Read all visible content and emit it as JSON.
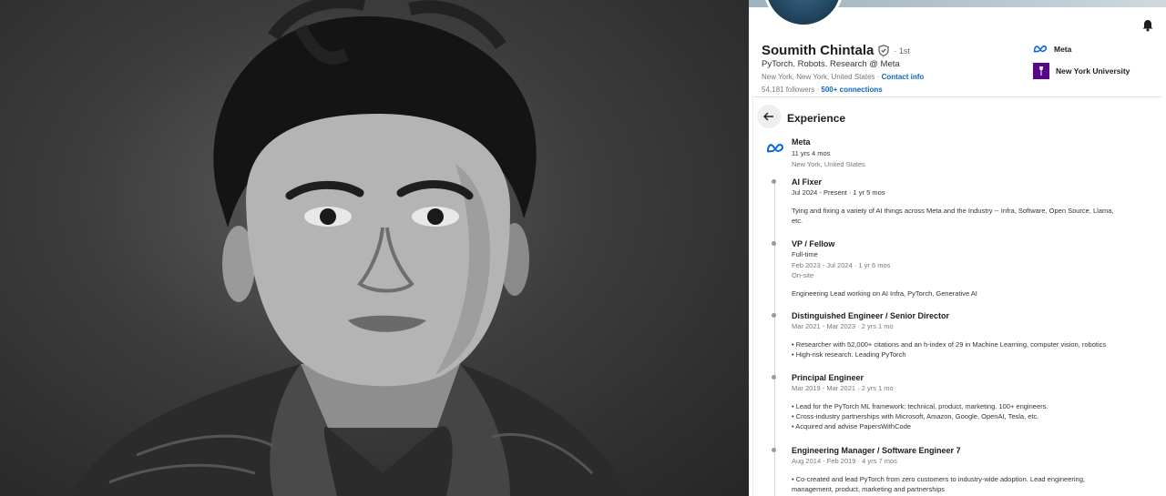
{
  "profile": {
    "name": "Soumith Chintala",
    "degree": "· 1st",
    "headline": "PyTorch. Robots. Research @ Meta",
    "location": "New York, New York, United States · ",
    "contact_info": "Contact info",
    "followers": "54,181 followers · ",
    "connections": "500+ connections",
    "current_company": "Meta",
    "education": "New York University"
  },
  "experience": {
    "section_title": "Experience",
    "company": {
      "name": "Meta",
      "duration": "11 yrs 4 mos",
      "location": "New York, United States"
    },
    "roles": [
      {
        "title": "AI Fixer",
        "dates": "Jul 2024 - Present · 1 yr 5 mos",
        "description": [
          "Tying and fixing a variety of AI things across Meta and the Industry -- Infra, Software, Open Source, Llama,",
          "etc."
        ]
      },
      {
        "title": "VP / Fellow",
        "type": "Full-time",
        "dates": "Feb 2023 - Jul 2024 · 1 yr 6 mos",
        "workplace": "On-site",
        "description": [
          "Engineering Lead working on AI Infra, PyTorch, Generative AI"
        ]
      },
      {
        "title": "Distinguished Engineer / Senior Director",
        "dates": "Mar 2021 - Mar 2023 · 2 yrs 1 mo",
        "description": [
          "• Researcher with 52,000+ citations and an h-index of 29 in Machine Learning, computer vision, robotics",
          "• High-risk research. Leading PyTorch"
        ]
      },
      {
        "title": "Principal Engineer",
        "dates": "Mar 2019 - Mar 2021 · 2 yrs 1 mo",
        "description": [
          "• Lead for the PyTorch ML framework: technical, product, marketing. 100+ engineers.",
          "• Cross-industry partnerships with Microsoft, Amazon, Google, OpenAI, Tesla, etc.",
          "• Acquired and advise PapersWithCode"
        ]
      },
      {
        "title": "Engineering Manager / Software Engineer 7",
        "dates": "Aug 2014 - Feb 2019 · 4 yrs 7 mos",
        "description": [
          "• Co-created and lead PyTorch from zero customers to industry-wide adoption. Lead engineering,",
          "management, product, marketing and partnerships"
        ]
      }
    ]
  },
  "icons": {
    "verified": "shield-check-icon",
    "bell": "bell-icon",
    "back": "arrow-left-icon",
    "meta_logo": "meta-logo-icon",
    "nyu_logo": "nyu-logo-icon"
  },
  "colors": {
    "link_blue": "#0a66c2",
    "meta_blue": "#0668e1",
    "nyu_purple": "#57068c"
  }
}
